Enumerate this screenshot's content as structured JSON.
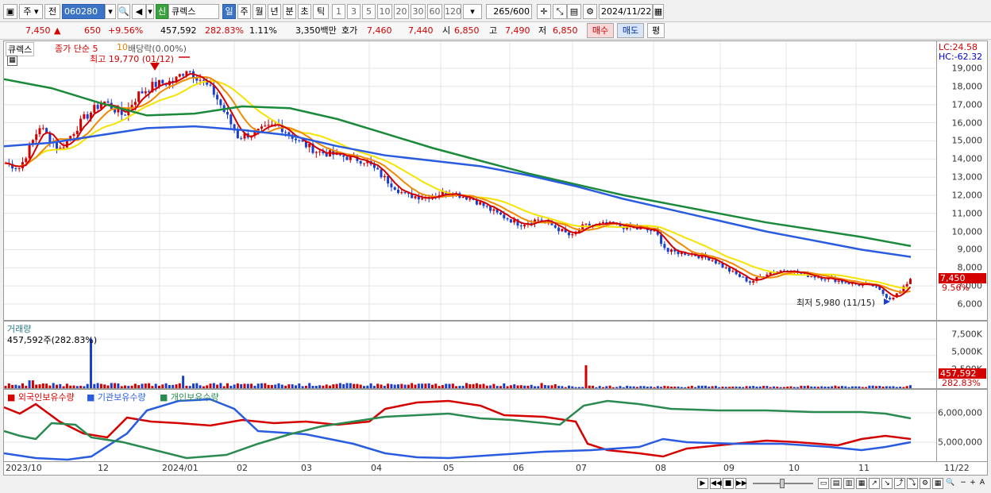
{
  "toolbar": {
    "period_main": "주",
    "prev_label": "전",
    "code": "060280",
    "name": "큐렉스",
    "badge": "신",
    "periods": [
      "일",
      "주",
      "월",
      "년",
      "분",
      "초",
      "틱"
    ],
    "intervals": [
      "1",
      "3",
      "5",
      "10",
      "20",
      "30",
      "60",
      "120"
    ],
    "count": "265",
    "count_total": "/600",
    "date": "2024/11/22",
    "tail": "평"
  },
  "quote": {
    "price": "7,450",
    "change": "650",
    "change_pct": "+9.56%",
    "volume": "457,592",
    "volume_pct": "282.83%",
    "turnover_pct": "1.11%",
    "amount": "3,350백만",
    "ask_label": "호가",
    "ask": "7,460",
    "bid": "7,440",
    "open_label": "시",
    "open": "6,850",
    "high_label": "고",
    "high": "7,490",
    "low_label": "저",
    "low": "6,850",
    "buy": "매수",
    "sell": "매도"
  },
  "price_pane": {
    "name": "큐렉스",
    "indicator": "종가 단순 5",
    "ma10": "10",
    "extra": "배당락(0.00%)",
    "max_label": "최고 19,770 (01/12)",
    "min_label": "최저 5,980 (11/15)",
    "lc": "LC:24.58",
    "hc": "HC:-62.32",
    "last_tag": "7,450",
    "pct_tag": "9.56%",
    "axis": [
      "19,000",
      "18,000",
      "17,000",
      "16,000",
      "15,000",
      "14,000",
      "13,000",
      "12,000",
      "11,000",
      "10,000",
      "9,000",
      "8,000",
      "7,000",
      "6,000"
    ],
    "colors": {
      "up": "#d40000",
      "down": "#1a3fd0",
      "ma5": "#d40000",
      "ma10": "#f08a00",
      "ma20": "#f5e400",
      "ma60": "#1a8a3a",
      "ma120": "#2a5ce0"
    }
  },
  "vol_pane": {
    "title": "거래량",
    "value": "457,592주(282.83%)",
    "axis": [
      "7,500K",
      "5,000K",
      "2,500K"
    ],
    "tag1": "457,592",
    "tag2": "282.83%"
  },
  "hold_pane": {
    "legend": [
      "외국인보유수량",
      "기관보유수량",
      "개인보유수량"
    ],
    "axis": [
      "6,000,000",
      "5,000,000"
    ],
    "colors": [
      "#d40000",
      "#2a5ce0",
      "#2a8a50"
    ]
  },
  "x_axis": [
    "2023/10",
    "12",
    "2024/01",
    "02",
    "03",
    "04",
    "05",
    "06",
    "07",
    "08",
    "09",
    "10",
    "11",
    "11/22"
  ]
}
